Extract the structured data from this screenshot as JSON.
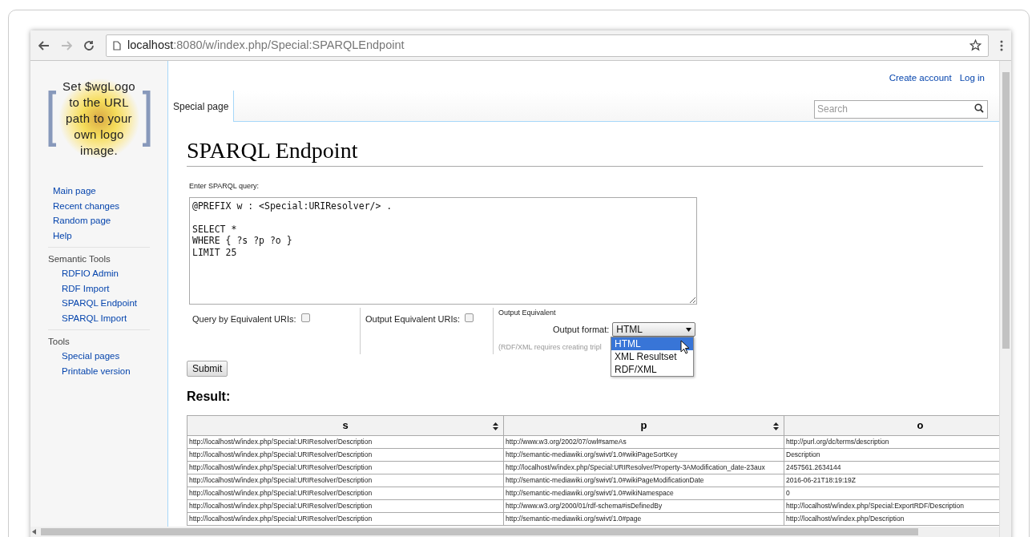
{
  "browser": {
    "url_host": "localhost",
    "url_path": ":8080/w/index.php/Special:SPARQLEndpoint"
  },
  "logo_text": "Set $wgLogo to the URL path to your own logo image.",
  "sidebar": {
    "nav": [
      "Main page",
      "Recent changes",
      "Random page",
      "Help"
    ],
    "sections": [
      {
        "heading": "Semantic Tools",
        "items": [
          "RDFIO Admin",
          "RDF Import",
          "SPARQL Endpoint",
          "SPARQL Import"
        ]
      },
      {
        "heading": "Tools",
        "items": [
          "Special pages",
          "Printable version"
        ]
      }
    ]
  },
  "personal_links": [
    "Create account",
    "Log in"
  ],
  "tabs": [
    {
      "label": "Special page",
      "selected": true
    }
  ],
  "search": {
    "placeholder": "Search"
  },
  "title": "SPARQL Endpoint",
  "query_label": "Enter SPARQL query:",
  "query": "@PREFIX w : <Special:URIResolver/> .\n\nSELECT *\nWHERE { ?s ?p ?o }\nLIMIT 25",
  "options": [
    {
      "kind": "checkbox",
      "label": "Query by Equivalent URIs:",
      "checked": false
    },
    {
      "kind": "checkbox",
      "label": "Output Equivalent URIs:",
      "checked": false
    },
    {
      "kind": "select",
      "heading": "Output Equivalent",
      "label": "Output format:",
      "value": "HTML",
      "expanded": true,
      "note": "(RDF/XML requires creating tripl",
      "choices": [
        {
          "label": "HTML",
          "selected": true
        },
        {
          "label": "XML Resultset",
          "selected": false
        },
        {
          "label": "RDF/XML",
          "selected": false
        }
      ]
    }
  ],
  "submit": "Submit",
  "result_heading": "Result:",
  "table": {
    "columns": [
      {
        "label": "s",
        "sortable": true
      },
      {
        "label": "p",
        "sortable": true
      },
      {
        "label": "o"
      }
    ],
    "rows": [
      [
        "http://localhost/w/index.php/Special:URIResolver/Description",
        "http://www.w3.org/2002/07/owl#sameAs",
        "http://purl.org/dc/terms/description"
      ],
      [
        "http://localhost/w/index.php/Special:URIResolver/Description",
        "http://semantic-mediawiki.org/swivt/1.0#wikiPageSortKey",
        "Description"
      ],
      [
        "http://localhost/w/index.php/Special:URIResolver/Description",
        "http://localhost/w/index.php/Special:URIResolver/Property-3AModification_date-23aux",
        "2457561.2634144"
      ],
      [
        "http://localhost/w/index.php/Special:URIResolver/Description",
        "http://semantic-mediawiki.org/swivt/1.0#wikiPageModificationDate",
        "2016-06-21T18:19:19Z"
      ],
      [
        "http://localhost/w/index.php/Special:URIResolver/Description",
        "http://semantic-mediawiki.org/swivt/1.0#wikiNamespace",
        "0"
      ],
      [
        "http://localhost/w/index.php/Special:URIResolver/Description",
        "http://www.w3.org/2000/01/rdf-schema#isDefinedBy",
        "http://localhost/w/index.php/Special:ExportRDF/Description"
      ],
      [
        "http://localhost/w/index.php/Special:URIResolver/Description",
        "http://semantic-mediawiki.org/swivt/1.0#page",
        "http://localhost/w/index.php/Description"
      ]
    ]
  }
}
